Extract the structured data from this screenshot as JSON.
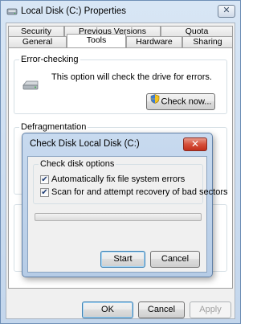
{
  "window": {
    "title": "Local Disk (C:) Properties",
    "close_symbol": "✕",
    "icon": "disk-icon"
  },
  "tabs": {
    "top_row": [
      "Security",
      "Previous Versions",
      "Quota"
    ],
    "bottom_row": [
      "General",
      "Tools",
      "Hardware",
      "Sharing"
    ],
    "selected": "Tools"
  },
  "error_checking": {
    "label": "Error-checking",
    "description": "This option will check the drive for errors.",
    "button": "Check now...",
    "icon": "drive-icon",
    "button_icon": "shield-icon"
  },
  "defragmentation": {
    "label": "Defragmentation"
  },
  "footer": {
    "ok": "OK",
    "cancel": "Cancel",
    "apply": "Apply"
  },
  "dialog": {
    "title": "Check Disk Local Disk (C:)",
    "close_symbol": "✕",
    "group_label": "Check disk options",
    "options": [
      {
        "label": "Automatically fix file system errors",
        "checked": true
      },
      {
        "label": "Scan for and attempt recovery of bad sectors",
        "checked": true
      }
    ],
    "progress": 0,
    "start": "Start",
    "cancel": "Cancel"
  }
}
